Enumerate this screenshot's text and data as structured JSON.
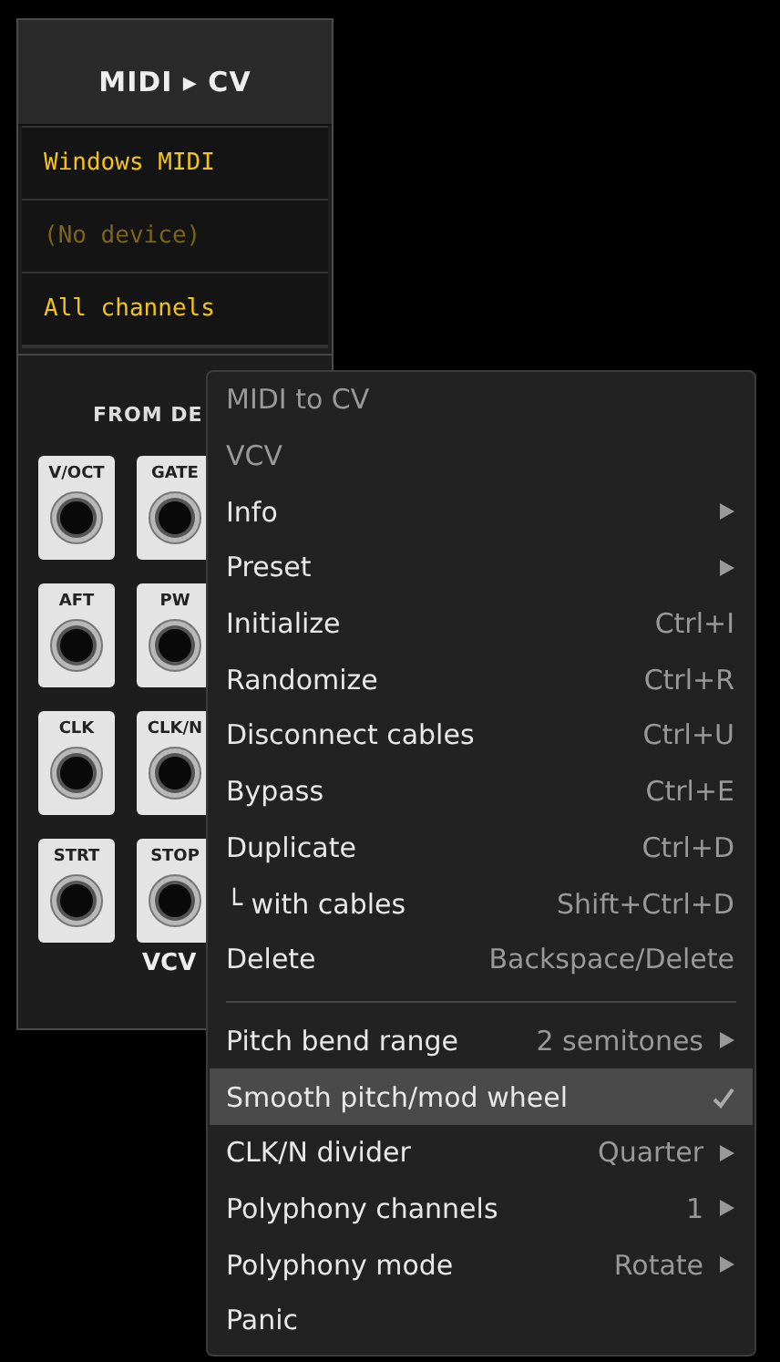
{
  "module": {
    "title": "MIDI ▸ CV",
    "displays": [
      {
        "text": "Windows MIDI",
        "disabled": false
      },
      {
        "text": "(No device)",
        "disabled": true
      },
      {
        "text": "All channels",
        "disabled": false
      }
    ],
    "section_label": "FROM DE",
    "jacks": [
      "V/OCT",
      "GATE",
      "AFT",
      "PW",
      "CLK",
      "CLK/N",
      "STRT",
      "STOP"
    ],
    "logo": "VCV"
  },
  "context_menu": {
    "items": [
      {
        "kind": "header",
        "label": "MIDI to CV"
      },
      {
        "kind": "header",
        "label": "VCV"
      },
      {
        "kind": "item",
        "label": "Info",
        "submenu": true,
        "selected": false
      },
      {
        "kind": "item",
        "label": "Preset",
        "submenu": true,
        "selected": false
      },
      {
        "kind": "item",
        "label": "Initialize",
        "shortcut": "Ctrl+I",
        "selected": false
      },
      {
        "kind": "item",
        "label": "Randomize",
        "shortcut": "Ctrl+R",
        "selected": false
      },
      {
        "kind": "item",
        "label": "Disconnect cables",
        "shortcut": "Ctrl+U",
        "selected": false
      },
      {
        "kind": "item",
        "label": "Bypass",
        "shortcut": "Ctrl+E",
        "selected": false
      },
      {
        "kind": "item",
        "label": "Duplicate",
        "shortcut": "Ctrl+D",
        "selected": false
      },
      {
        "kind": "item",
        "label": "└ with cables",
        "shortcut": "Shift+Ctrl+D",
        "selected": false
      },
      {
        "kind": "item",
        "label": "Delete",
        "shortcut": "Backspace/Delete",
        "selected": false
      },
      {
        "kind": "separator"
      },
      {
        "kind": "item",
        "label": "Pitch bend range",
        "shortcut": "2 semitones",
        "submenu": true,
        "selected": false
      },
      {
        "kind": "item",
        "label": "Smooth pitch/mod wheel",
        "checked": true,
        "selected": true
      },
      {
        "kind": "item",
        "label": "CLK/N divider",
        "shortcut": "Quarter",
        "submenu": true,
        "selected": false
      },
      {
        "kind": "item",
        "label": "Polyphony channels",
        "shortcut": "1",
        "submenu": true,
        "selected": false
      },
      {
        "kind": "item",
        "label": "Polyphony mode",
        "shortcut": "Rotate",
        "submenu": true,
        "selected": false
      },
      {
        "kind": "item",
        "label": "Panic",
        "selected": false
      }
    ]
  }
}
